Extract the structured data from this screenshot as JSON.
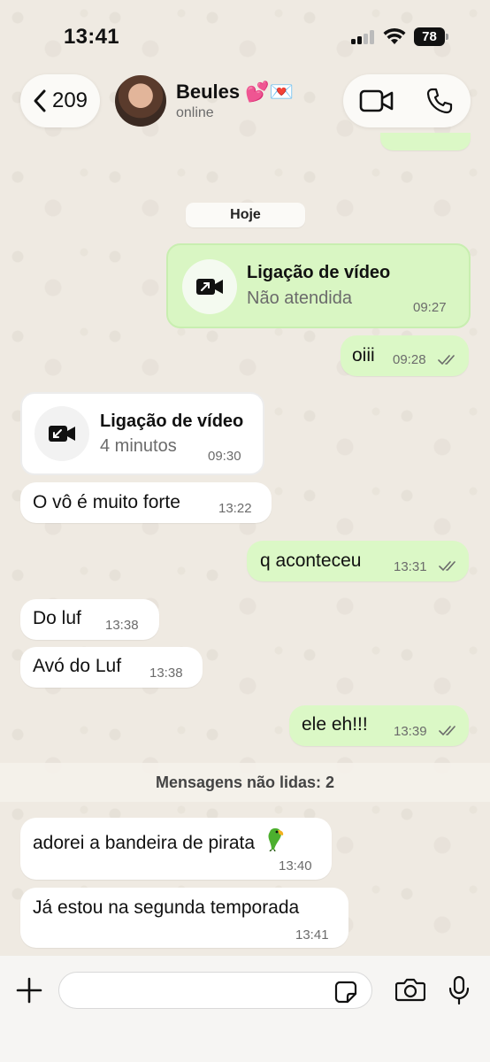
{
  "status_bar": {
    "time": "13:41",
    "battery": "78"
  },
  "header": {
    "back_count": "209",
    "contact_name": "Beules 💕💌",
    "contact_status": "online"
  },
  "chat": {
    "date_chip": "Hoje",
    "call_out": {
      "title": "Ligação de vídeo",
      "subtitle": "Não atendida",
      "time": "09:27"
    },
    "msg_oiii": {
      "text": "oiii",
      "time": "09:28"
    },
    "call_in": {
      "title": "Ligação de vídeo",
      "subtitle": "4 minutos",
      "time": "09:30"
    },
    "msg_vo": {
      "text": "O vô é muito forte",
      "time": "13:22"
    },
    "msg_aconteceu": {
      "text": "q aconteceu",
      "time": "13:31"
    },
    "msg_doluf": {
      "text": "Do luf",
      "time": "13:38"
    },
    "msg_avo": {
      "text": "Avó do Luf",
      "time": "13:38"
    },
    "msg_eleeh": {
      "text": "ele eh!!!",
      "time": "13:39"
    },
    "unread_banner": "Mensagens não lidas: 2",
    "msg_bandeira": {
      "text": "adorei a bandeira de pirata",
      "time": "13:40"
    },
    "msg_temporada": {
      "text": "Já estou na segunda temporada",
      "time": "13:41"
    }
  },
  "icons": {
    "back": "chevron-left-icon",
    "video_call": "video-camera-icon",
    "voice_call": "phone-icon",
    "plus": "plus-icon",
    "sticker": "sticker-icon",
    "camera": "camera-icon",
    "mic": "microphone-icon"
  },
  "colors": {
    "incoming_bubble": "#ffffff",
    "outgoing_bubble": "#dbf8c6",
    "chat_background": "#efeae2"
  }
}
